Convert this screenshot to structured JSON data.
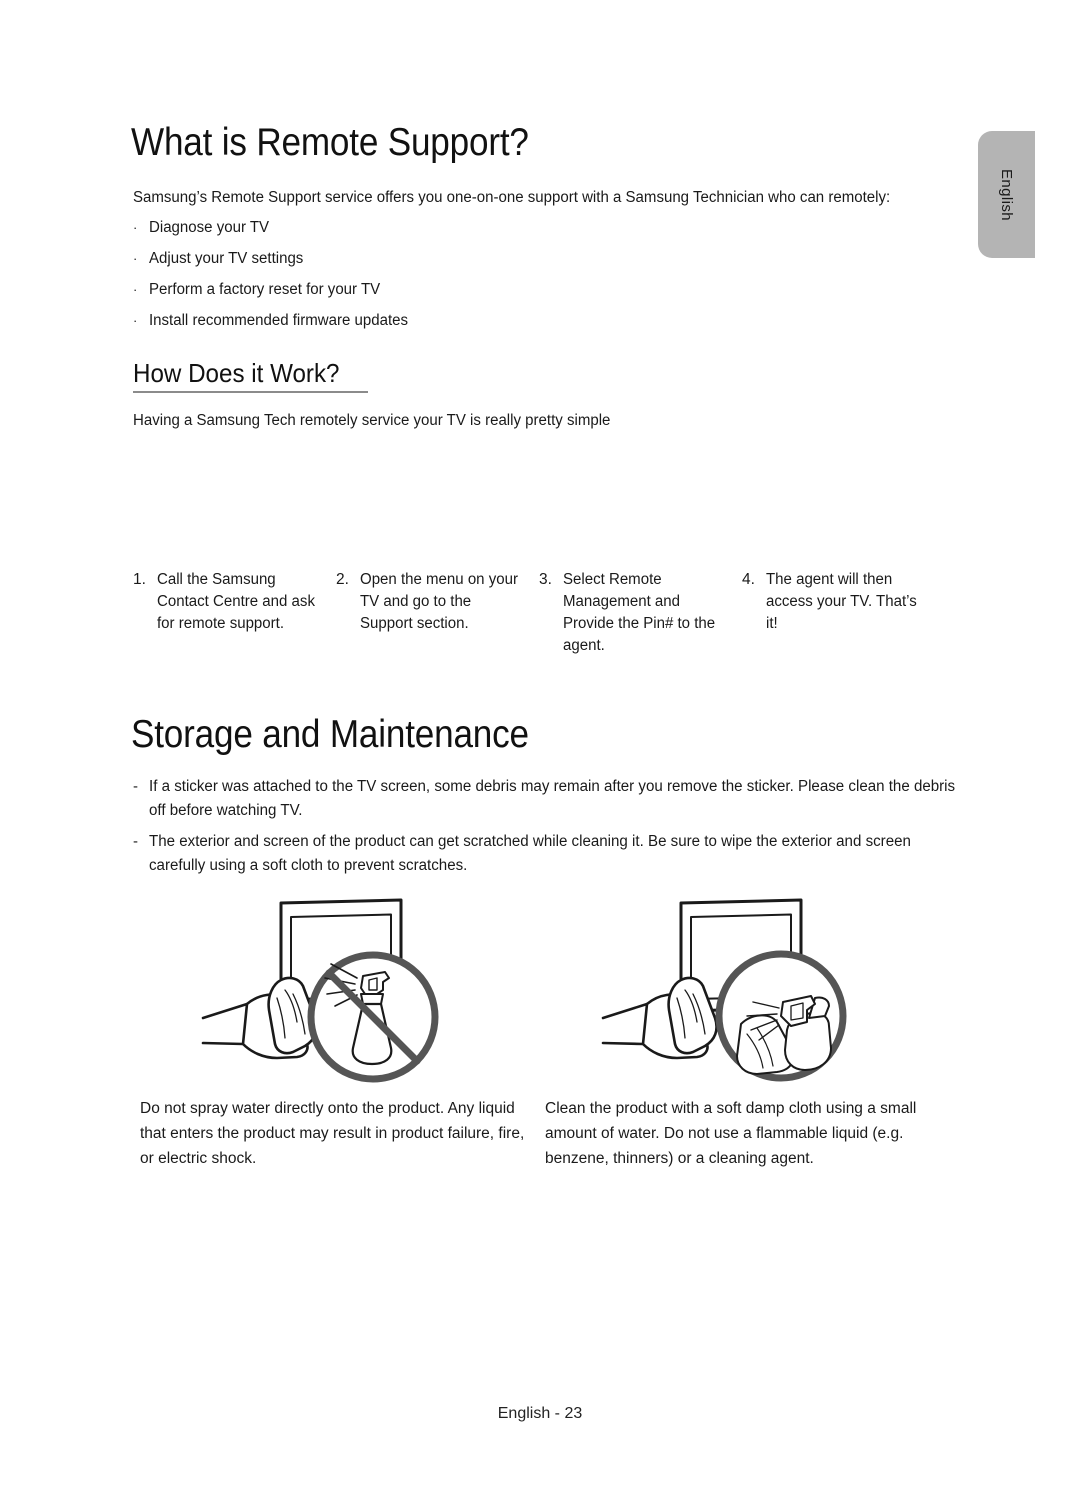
{
  "page": {
    "language_tab": "English",
    "footer": "English - 23"
  },
  "remote_support": {
    "title": "What is Remote Support?",
    "intro": "Samsung’s Remote Support service offers you one-on-one support with a Samsung Technician who can remotely:",
    "bullet_mark": "·",
    "bullets": [
      "Diagnose your TV",
      "Adjust your TV settings",
      "Perform a factory reset for your TV",
      "Install recommended firmware updates"
    ]
  },
  "how_it_works": {
    "title": "How Does it Work?",
    "lead": "Having a Samsung Tech remotely service your TV is really pretty simple",
    "steps": [
      {
        "number": "1.",
        "text": "Call the Samsung Contact Centre and ask for remote support."
      },
      {
        "number": "2.",
        "text": "Open the menu on your TV and go to the Support section."
      },
      {
        "number": "3.",
        "text": "Select Remote Management and Provide the Pin# to the agent."
      },
      {
        "number": "4.",
        "text": "The agent will then access your TV. That’s it!"
      }
    ]
  },
  "storage_maintenance": {
    "title": "Storage and Maintenance",
    "dash_mark": "-",
    "notes": [
      "If a sticker was attached to the TV screen, some debris may remain after you remove the sticker. Please clean the debris off before watching TV.",
      "The exterior and screen of the product can get scratched while cleaning it. Be sure to wipe the exterior and screen carefully using a soft cloth to prevent scratches."
    ],
    "figures": [
      {
        "name": "no-spray",
        "caption": "Do not spray water directly onto the product. Any liquid that enters the product may result in product failure, fire, or electric shock."
      },
      {
        "name": "damp-cloth",
        "caption": "Clean the product with a soft damp cloth using a small amount of water. Do not use a flammable liquid (e.g. benzene, thinners) or a cleaning agent."
      }
    ]
  }
}
